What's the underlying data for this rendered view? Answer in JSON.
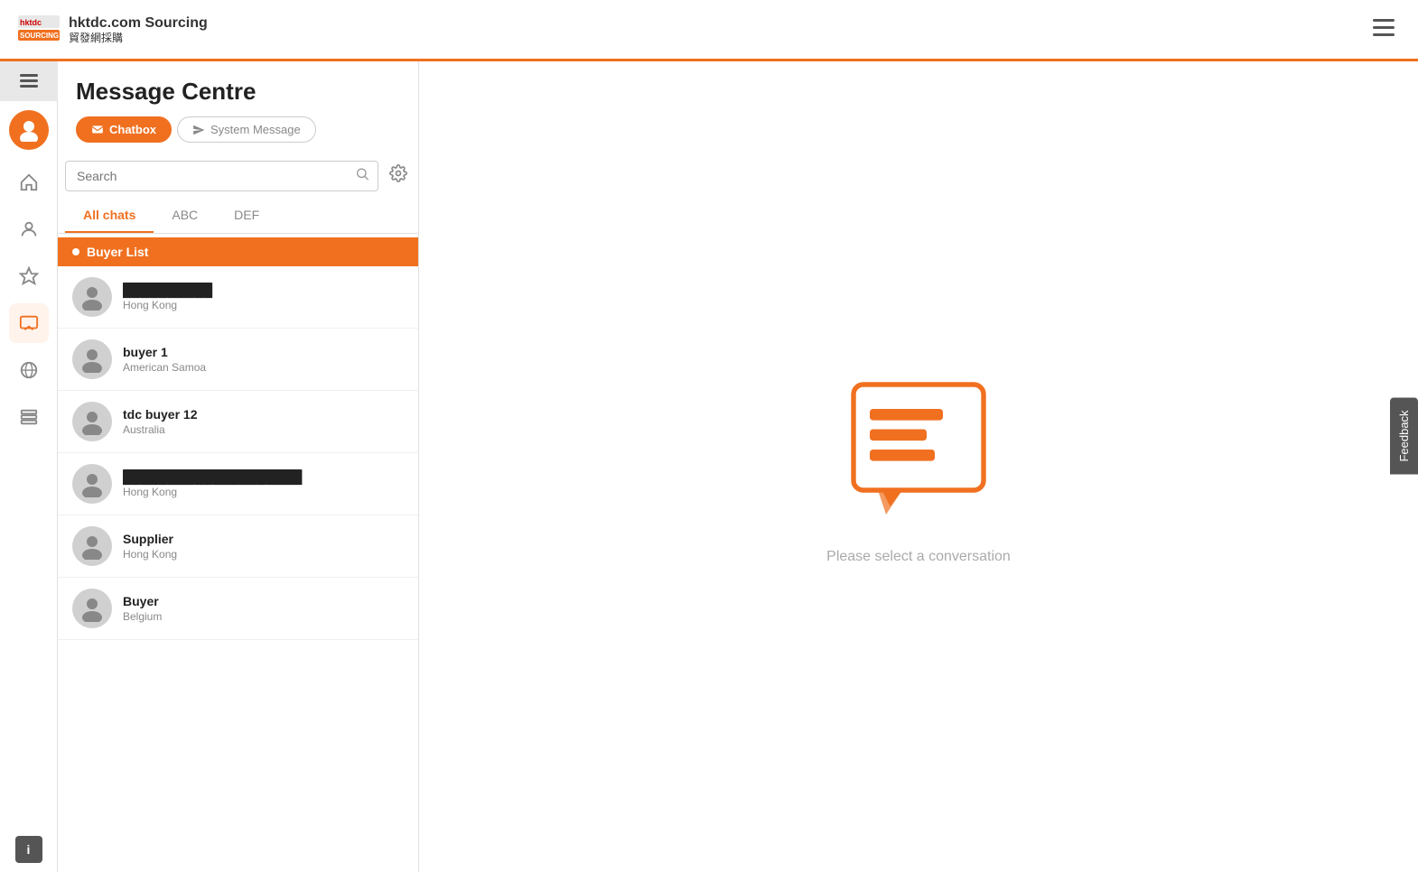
{
  "header": {
    "site_name": "hktdc.com Sourcing",
    "site_sub": "貿發網採購",
    "hamburger_label": "☰"
  },
  "page": {
    "title": "Message Centre"
  },
  "tabs": {
    "chatbox_label": "Chatbox",
    "system_message_label": "System Message"
  },
  "search": {
    "placeholder": "Search"
  },
  "filter_tabs": [
    {
      "id": "all",
      "label": "All chats",
      "active": true
    },
    {
      "id": "abc",
      "label": "ABC",
      "active": false
    },
    {
      "id": "def",
      "label": "DEF",
      "active": false
    }
  ],
  "buyer_list": {
    "header": "Buyer List",
    "items": [
      {
        "id": 1,
        "name": "██████████",
        "location": "Hong Kong",
        "redacted": true
      },
      {
        "id": 2,
        "name": "buyer 1",
        "location": "American Samoa",
        "redacted": false
      },
      {
        "id": 3,
        "name": "tdc buyer 12",
        "location": "Australia",
        "redacted": false
      },
      {
        "id": 4,
        "name": "████████████████████",
        "location": "Hong Kong",
        "redacted": true
      },
      {
        "id": 5,
        "name": "Supplier",
        "location": "Hong Kong",
        "redacted": false
      },
      {
        "id": 6,
        "name": "Buyer",
        "location": "Belgium",
        "redacted": false
      }
    ]
  },
  "conversation": {
    "placeholder_text": "Please select a conversation"
  },
  "feedback": {
    "label": "Feedback"
  },
  "nav": {
    "info_label": "i"
  }
}
